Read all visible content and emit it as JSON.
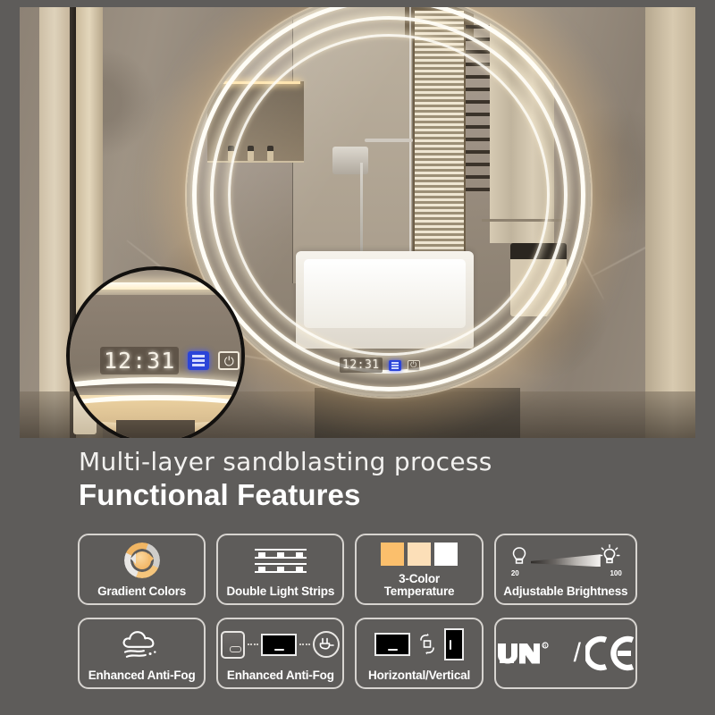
{
  "hero": {
    "product": "round-led-bathroom-mirror",
    "mirror_display": {
      "clock": "12:31",
      "antifog_button_icon": "defog-icon",
      "power_button_icon": "power-icon",
      "antifog_button_color": "#2b44d8"
    },
    "magnifier_inset": {
      "clock": "12:31",
      "antifog_button_icon": "defog-icon",
      "power_button_icon": "power-icon",
      "power_glyph": "⏻"
    }
  },
  "headings": {
    "subtitle": "Multi-layer sandblasting process",
    "title": "Functional Features"
  },
  "features": [
    {
      "id": "gradient-colors",
      "label": "Gradient Colors",
      "icon": "gradient-colors-icon",
      "colors": {
        "accent": "#f0ab53",
        "silver": "#e9e7e4"
      }
    },
    {
      "id": "double-light-strips",
      "label": "Double Light Strips",
      "icon": "double-light-strips-icon"
    },
    {
      "id": "3-color-temperature",
      "label": "3-Color\nTemperature",
      "icon": "color-temperature-icon",
      "swatches": [
        "#fbbf6c",
        "#fcdfb8",
        "#ffffff"
      ]
    },
    {
      "id": "adjustable-brightness",
      "label": "Adjustable Brightness",
      "icon": "adjustable-brightness-icon",
      "min": "20",
      "max": "100"
    },
    {
      "id": "enhanced-anti-fog-cloud",
      "label": "Enhanced Anti-Fog",
      "icon": "anti-fog-cloud-icon"
    },
    {
      "id": "enhanced-anti-fog-wiring",
      "label": "Enhanced Anti-Fog",
      "icon": "switch-display-plug-icon"
    },
    {
      "id": "horizontal-vertical",
      "label": "Horizontal/Vertical",
      "icon": "rotate-orientation-icon"
    },
    {
      "id": "certifications",
      "label": "",
      "icon": "ul-ce-certification-icon",
      "ul_mark": "UL",
      "registered": "®",
      "separator": "/",
      "ce_mark": "CE"
    }
  ],
  "theme": {
    "background": "#5e5c5a",
    "card_border": "#d7d4d0",
    "text": "#ffffff",
    "led_warm": "#ffe2a8"
  }
}
